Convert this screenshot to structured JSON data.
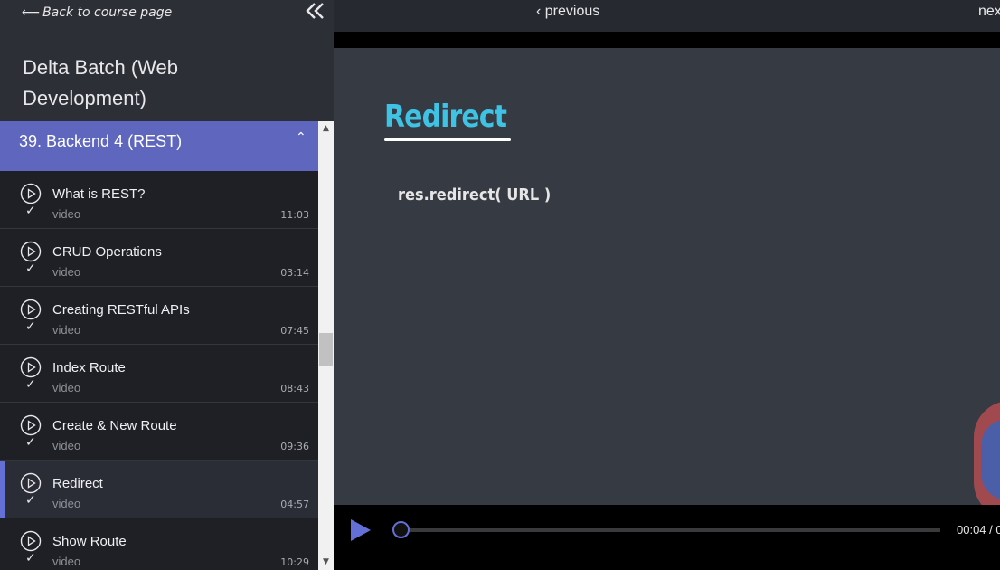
{
  "sidebar": {
    "back_link": "Back to course page",
    "course_title": "Delta Batch (Web Development)",
    "section": {
      "label": "39. Backend 4 (REST)",
      "expanded": true
    },
    "lessons": [
      {
        "title": "What is REST?",
        "type": "video",
        "duration": "11:03",
        "completed": true
      },
      {
        "title": "CRUD Operations",
        "type": "video",
        "duration": "03:14",
        "completed": true
      },
      {
        "title": "Creating RESTful APIs",
        "type": "video",
        "duration": "07:45",
        "completed": true
      },
      {
        "title": "Index Route",
        "type": "video",
        "duration": "08:43",
        "completed": true
      },
      {
        "title": "Create & New Route",
        "type": "video",
        "duration": "09:36",
        "completed": true
      },
      {
        "title": "Redirect",
        "type": "video",
        "duration": "04:57",
        "completed": true,
        "active": true
      },
      {
        "title": "Show Route",
        "type": "video",
        "duration": "10:29",
        "completed": true
      }
    ]
  },
  "nav": {
    "previous_label": "previous",
    "next_label": "next"
  },
  "video": {
    "slide_title": "Redirect",
    "slide_code": "res.redirect( URL )",
    "current_time": "00:04 / 0",
    "progress_fraction": 0.01
  },
  "colors": {
    "accent": "#6470d6",
    "section_header": "#5e66bd",
    "slide_title": "#3fc3e4"
  }
}
